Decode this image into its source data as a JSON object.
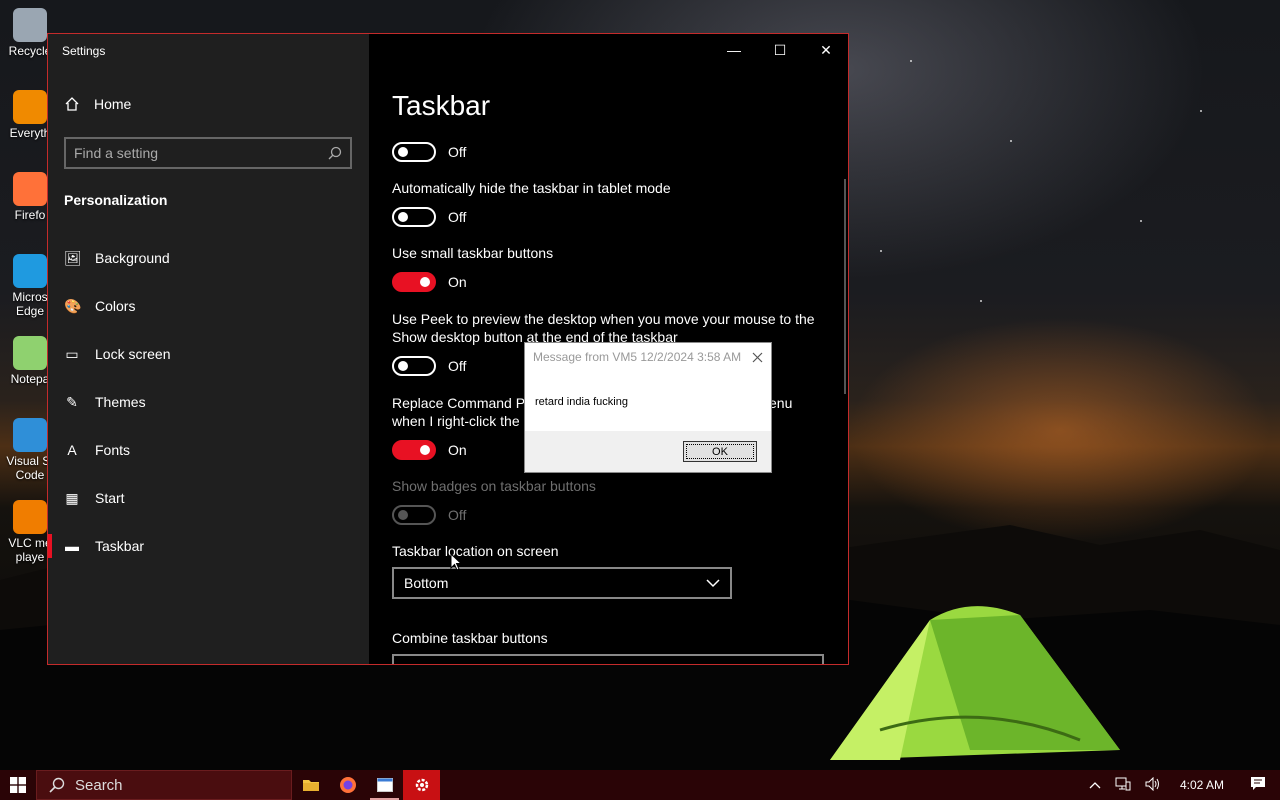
{
  "desktop": {
    "icons": [
      {
        "label": "Recycle",
        "color": "#9aa6b2"
      },
      {
        "label": "Everyth",
        "color": "#f08a00"
      },
      {
        "label": "Firefo",
        "color": "#ff7139"
      },
      {
        "label": "Micros Edge",
        "color": "#1f9ae0"
      },
      {
        "label": "Notepa",
        "color": "#8fd16f"
      },
      {
        "label": "Visual St Code",
        "color": "#2f8fd8"
      },
      {
        "label": "VLC me playe",
        "color": "#f07d00"
      }
    ]
  },
  "settings": {
    "window_title": "Settings",
    "caption": {
      "minimize": "—",
      "maximize": "☐",
      "close": "✕"
    },
    "home_label": "Home",
    "search_placeholder": "Find a setting",
    "section": "Personalization",
    "nav": [
      {
        "label": "Background",
        "icon": "🖼",
        "active": false
      },
      {
        "label": "Colors",
        "icon": "🎨",
        "active": false
      },
      {
        "label": "Lock screen",
        "icon": "▭",
        "active": false
      },
      {
        "label": "Themes",
        "icon": "✎",
        "active": false
      },
      {
        "label": "Fonts",
        "icon": "A",
        "active": false
      },
      {
        "label": "Start",
        "icon": "▦",
        "active": false
      },
      {
        "label": "Taskbar",
        "icon": "▬",
        "active": true
      }
    ],
    "page_title": "Taskbar",
    "options": [
      {
        "label": "",
        "state": "Off"
      },
      {
        "label": "Automatically hide the taskbar in tablet mode",
        "state": "Off"
      },
      {
        "label": "Use small taskbar buttons",
        "state": "On"
      },
      {
        "label": "Use Peek to preview the desktop when you move your mouse to the Show desktop button at the end of the taskbar",
        "state": "Off"
      },
      {
        "label": "Replace Command Pr",
        "label_tail": "enu",
        "label_line2": "when I right-click the",
        "state": "On"
      },
      {
        "label": "Show badges on taskbar buttons",
        "state": "Off",
        "disabled": true
      }
    ],
    "location_label": "Taskbar location on screen",
    "location_value": "Bottom",
    "combine_label": "Combine taskbar buttons"
  },
  "message_box": {
    "title": "Message from VM5 12/2/2024 3:58 AM",
    "body": "retard india fucking",
    "ok": "OK"
  },
  "taskbar": {
    "search_label": "Search",
    "apps": [
      "file-explorer",
      "firefox",
      "app-window",
      "settings"
    ],
    "time": "4:02 AM",
    "accent": "#c81013"
  }
}
